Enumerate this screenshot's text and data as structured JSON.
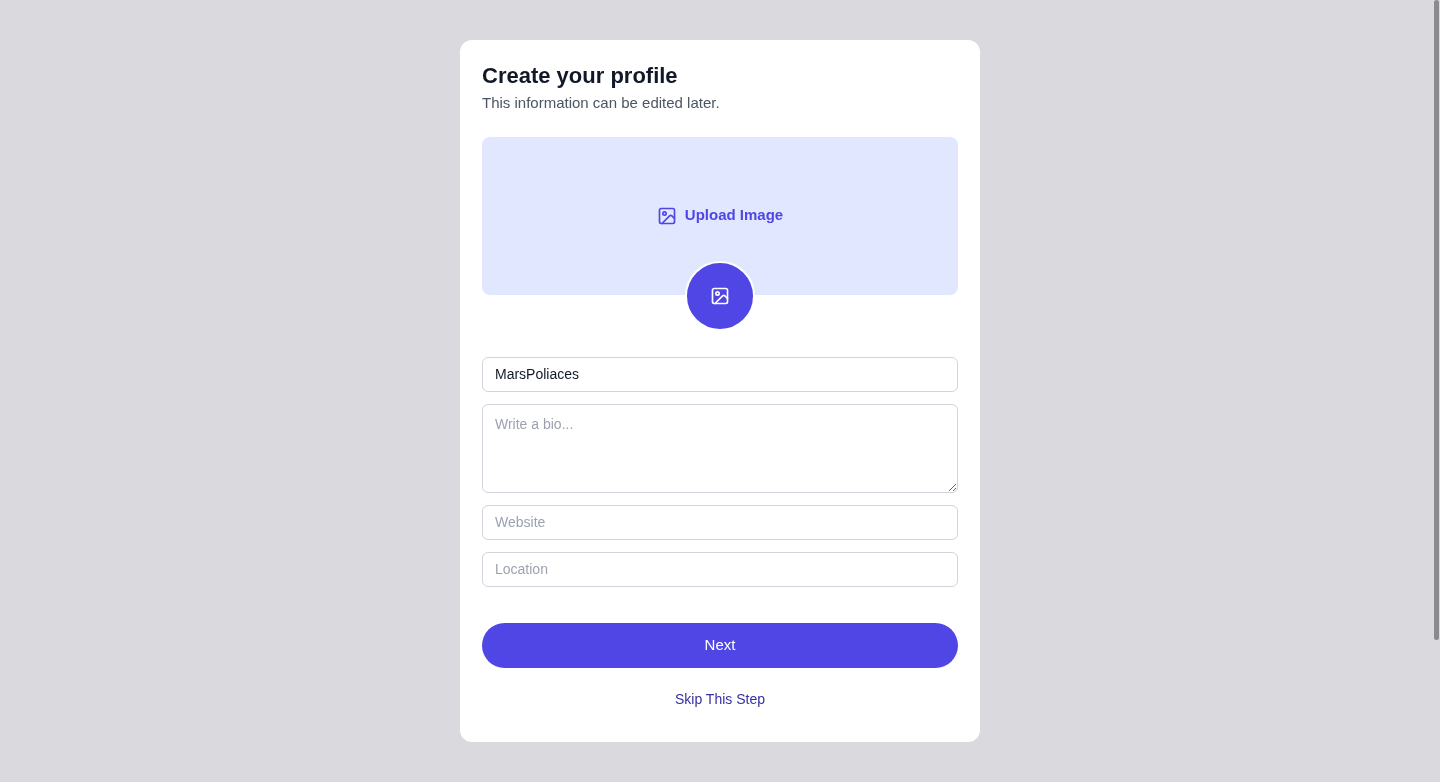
{
  "modal": {
    "title": "Create your profile",
    "subtitle": "This information can be edited later.",
    "upload": {
      "label": "Upload Image"
    },
    "fields": [
      {
        "kind": "input",
        "value": "MarsPoliaces"
      },
      {
        "kind": "textarea",
        "placeholder": "Write a bio..."
      },
      {
        "kind": "input",
        "placeholder": "Website"
      },
      {
        "kind": "input",
        "placeholder": "Location"
      }
    ],
    "primary_button": "Next",
    "secondary_link": "Skip This Step"
  }
}
